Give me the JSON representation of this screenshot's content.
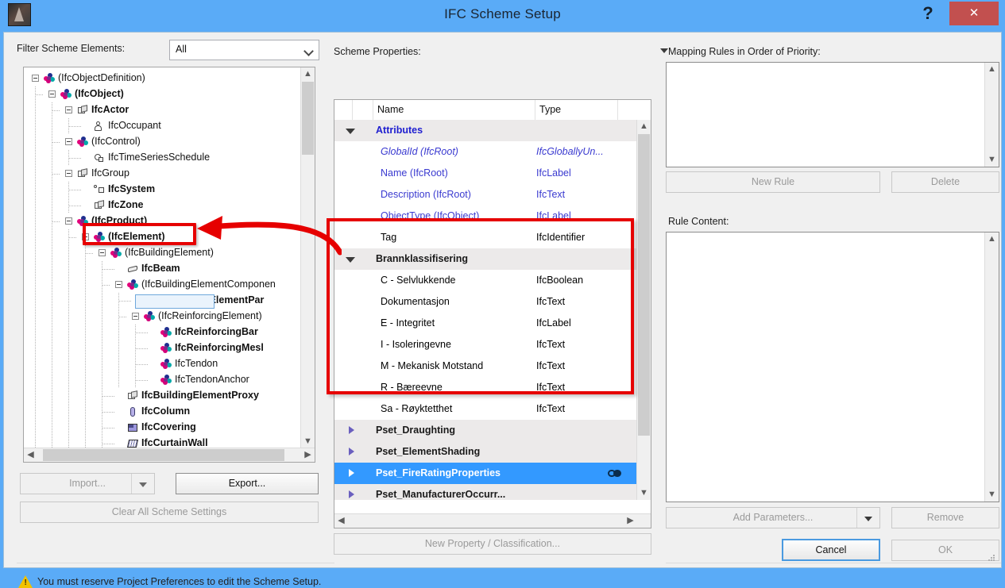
{
  "window": {
    "title": "IFC Scheme Setup",
    "help_label": "?",
    "close_label": "✕"
  },
  "left_panel": {
    "filter_label": "Filter Scheme Elements:",
    "filter_value": "All",
    "tree": [
      {
        "label": "(IfcObjectDefinition)",
        "depth": 0,
        "bold": false,
        "expander": true,
        "icon": "mol"
      },
      {
        "label": "(IfcObject)",
        "depth": 1,
        "bold": true,
        "expander": true,
        "icon": "mol"
      },
      {
        "label": "IfcActor",
        "depth": 2,
        "bold": true,
        "expander": true,
        "icon": "box3d"
      },
      {
        "label": "IfcOccupant",
        "depth": 3,
        "bold": false,
        "expander": false,
        "icon": "person"
      },
      {
        "label": "(IfcControl)",
        "depth": 2,
        "bold": false,
        "expander": true,
        "icon": "mol"
      },
      {
        "label": "IfcTimeSeriesSchedule",
        "depth": 3,
        "bold": false,
        "expander": false,
        "icon": "oval"
      },
      {
        "label": "IfcGroup",
        "depth": 2,
        "bold": false,
        "expander": true,
        "icon": "box3d"
      },
      {
        "label": "IfcSystem",
        "depth": 3,
        "bold": true,
        "expander": false,
        "icon": "sys"
      },
      {
        "label": "IfcZone",
        "depth": 3,
        "bold": true,
        "expander": false,
        "icon": "box3d"
      },
      {
        "label": "(IfcProduct)",
        "depth": 2,
        "bold": true,
        "expander": true,
        "icon": "mol"
      },
      {
        "label": "(IfcElement)",
        "depth": 3,
        "bold": true,
        "expander": true,
        "icon": "mol",
        "selected": true
      },
      {
        "label": "(IfcBuildingElement)",
        "depth": 4,
        "bold": false,
        "expander": true,
        "icon": "mol"
      },
      {
        "label": "IfcBeam",
        "depth": 5,
        "bold": true,
        "expander": false,
        "icon": "beam"
      },
      {
        "label": "(IfcBuildingElementComponen",
        "depth": 5,
        "bold": false,
        "expander": true,
        "icon": "mol"
      },
      {
        "label": "IfcBuildingElementPar",
        "depth": 6,
        "bold": true,
        "expander": false,
        "icon": "mol"
      },
      {
        "label": "(IfcReinforcingElement)",
        "depth": 6,
        "bold": false,
        "expander": true,
        "icon": "mol"
      },
      {
        "label": "IfcReinforcingBar",
        "depth": 7,
        "bold": true,
        "expander": false,
        "icon": "mol"
      },
      {
        "label": "IfcReinforcingMesl",
        "depth": 7,
        "bold": true,
        "expander": false,
        "icon": "mol"
      },
      {
        "label": "IfcTendon",
        "depth": 7,
        "bold": false,
        "expander": false,
        "icon": "mol"
      },
      {
        "label": "IfcTendonAnchor",
        "depth": 7,
        "bold": false,
        "expander": false,
        "icon": "mol"
      },
      {
        "label": "IfcBuildingElementProxy",
        "depth": 5,
        "bold": true,
        "expander": false,
        "icon": "box3d"
      },
      {
        "label": "IfcColumn",
        "depth": 5,
        "bold": true,
        "expander": false,
        "icon": "cyl"
      },
      {
        "label": "IfcCovering",
        "depth": 5,
        "bold": true,
        "expander": false,
        "icon": "plate"
      },
      {
        "label": "IfcCurtainWall",
        "depth": 5,
        "bold": true,
        "expander": false,
        "icon": "grid"
      }
    ],
    "import_label": "Import...",
    "export_label": "Export...",
    "clear_label": "Clear All Scheme Settings"
  },
  "middle_panel": {
    "title": "Scheme Properties:",
    "columns": [
      "Name",
      "Type"
    ],
    "rows": [
      {
        "kind": "group",
        "name": "Attributes",
        "type": "",
        "style": "blue"
      },
      {
        "kind": "property",
        "name": "GlobalId (IfcRoot)",
        "type": "IfcGloballyUn...",
        "style": "attr ital"
      },
      {
        "kind": "property",
        "name": "Name (IfcRoot)",
        "type": "IfcLabel",
        "style": "attr"
      },
      {
        "kind": "property",
        "name": "Description (IfcRoot)",
        "type": "IfcText",
        "style": "attr"
      },
      {
        "kind": "property",
        "name": "ObjectType (IfcObject)",
        "type": "IfcLabel",
        "style": "attr"
      },
      {
        "kind": "property",
        "name": "Tag",
        "type": "IfcIdentifier",
        "style": ""
      },
      {
        "kind": "group",
        "name": "Brannklassifisering",
        "type": "",
        "style": ""
      },
      {
        "kind": "property",
        "name": "C - Selvlukkende",
        "type": "IfcBoolean",
        "style": ""
      },
      {
        "kind": "property",
        "name": "Dokumentasjon",
        "type": "IfcText",
        "style": ""
      },
      {
        "kind": "property",
        "name": "E - Integritet",
        "type": "IfcLabel",
        "style": ""
      },
      {
        "kind": "property",
        "name": "I - Isoleringevne",
        "type": "IfcText",
        "style": ""
      },
      {
        "kind": "property",
        "name": "M - Mekanisk Motstand",
        "type": "IfcText",
        "style": ""
      },
      {
        "kind": "property",
        "name": "R - Bæreevne",
        "type": "IfcText",
        "style": ""
      },
      {
        "kind": "property",
        "name": "Sa - Røyktetthet",
        "type": "IfcText",
        "style": ""
      },
      {
        "kind": "collapsed",
        "name": "Pset_Draughting",
        "type": "",
        "style": ""
      },
      {
        "kind": "collapsed",
        "name": "Pset_ElementShading",
        "type": "",
        "style": ""
      },
      {
        "kind": "collapsed",
        "name": "Pset_FireRatingProperties",
        "type": "",
        "style": "",
        "selected": true,
        "link_icon": true
      },
      {
        "kind": "collapsed",
        "name": "Pset_ManufacturerOccurr...",
        "type": "",
        "style": ""
      }
    ],
    "new_property_label": "New Property / Classification..."
  },
  "right_panel": {
    "mapping_title": "Mapping Rules in Order of Priority:",
    "new_rule_label": "New Rule",
    "delete_label": "Delete",
    "rule_content_title": "Rule Content:",
    "add_parameters_label": "Add Parameters...",
    "remove_label": "Remove"
  },
  "footer": {
    "status_text": "You must reserve Project Preferences to edit the Scheme Setup.",
    "cancel_label": "Cancel",
    "ok_label": "OK"
  },
  "colors": {
    "titlebar": "#5aabf7",
    "close": "#c2504f",
    "selection": "#3399ff",
    "annotation": "#e60000"
  }
}
